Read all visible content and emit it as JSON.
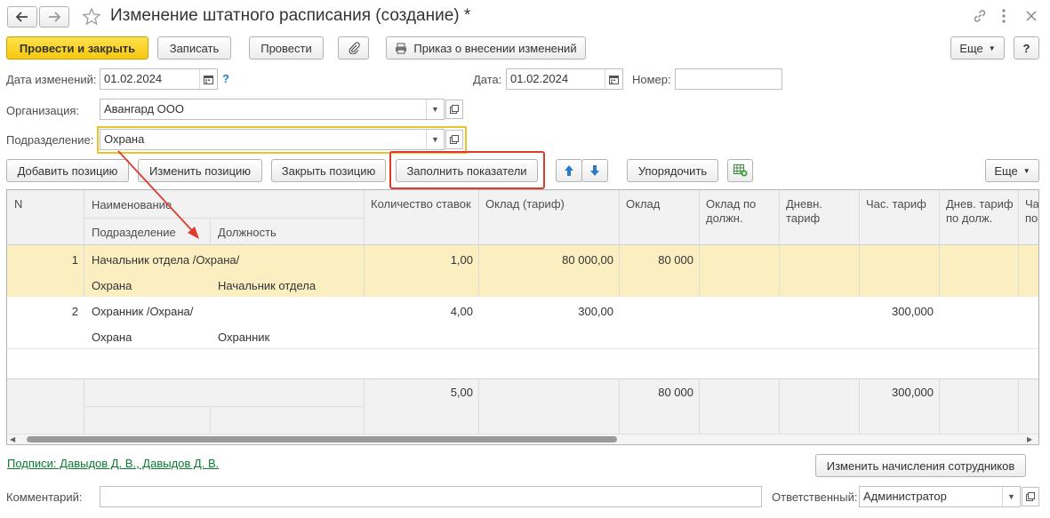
{
  "window": {
    "title": "Изменение штатного расписания (создание) *"
  },
  "toolbar": {
    "post_close": "Провести и закрыть",
    "save": "Записать",
    "post": "Провести",
    "order": "Приказ о внесении изменений",
    "more": "Еще",
    "help": "?"
  },
  "form": {
    "change_date_label": "Дата изменений:",
    "change_date_value": "01.02.2024",
    "change_date_hint": "?",
    "date_label": "Дата:",
    "date_value": "01.02.2024",
    "number_label": "Номер:",
    "number_value": "",
    "org_label": "Организация:",
    "org_value": "Авангард ООО",
    "dept_label": "Подразделение:",
    "dept_value": "Охрана"
  },
  "table_toolbar": {
    "add": "Добавить позицию",
    "edit": "Изменить позицию",
    "close": "Закрыть позицию",
    "fill": "Заполнить показатели",
    "sort": "Упорядочить",
    "more": "Еще"
  },
  "table": {
    "headers": {
      "n": "N",
      "name": "Наименование",
      "dept": "Подразделение",
      "position": "Должность",
      "rates": "Количество ставок",
      "salary_tariff": "Оклад (тариф)",
      "salary": "Оклад",
      "salary_by_pos": "Оклад по должн.",
      "daily": "Дневн. тариф",
      "hourly": "Час. тариф",
      "daily_by_pos": "Днев. тариф по долж.",
      "cut": "Ча по"
    },
    "rows": [
      {
        "n": "1",
        "name": "Начальник отдела /Охрана/",
        "dept": "Охрана",
        "position": "Начальник отдела",
        "rates": "1,00",
        "salary_tariff": "80 000,00",
        "salary": "80 000",
        "hourly": ""
      },
      {
        "n": "2",
        "name": "Охранник /Охрана/",
        "dept": "Охрана",
        "position": "Охранник",
        "rates": "4,00",
        "salary_tariff": "300,00",
        "salary": "",
        "hourly": "300,000"
      }
    ],
    "footer": {
      "rates": "5,00",
      "salary": "80 000",
      "hourly": "300,000"
    }
  },
  "bottom": {
    "signatures": "Подписи: Давыдов Д. В., Давыдов Д. В.",
    "change_accruals": "Изменить начисления сотрудников",
    "comment_label": "Комментарий:",
    "comment_value": "",
    "responsible_label": "Ответственный:",
    "responsible_value": "Администратор"
  },
  "colors": {
    "primary_button": "#f6c90e",
    "selected_row": "#fbefc2",
    "highlight_frame": "#e03a2f",
    "link": "#0a7a30",
    "focus_border": "#e8c32a"
  }
}
